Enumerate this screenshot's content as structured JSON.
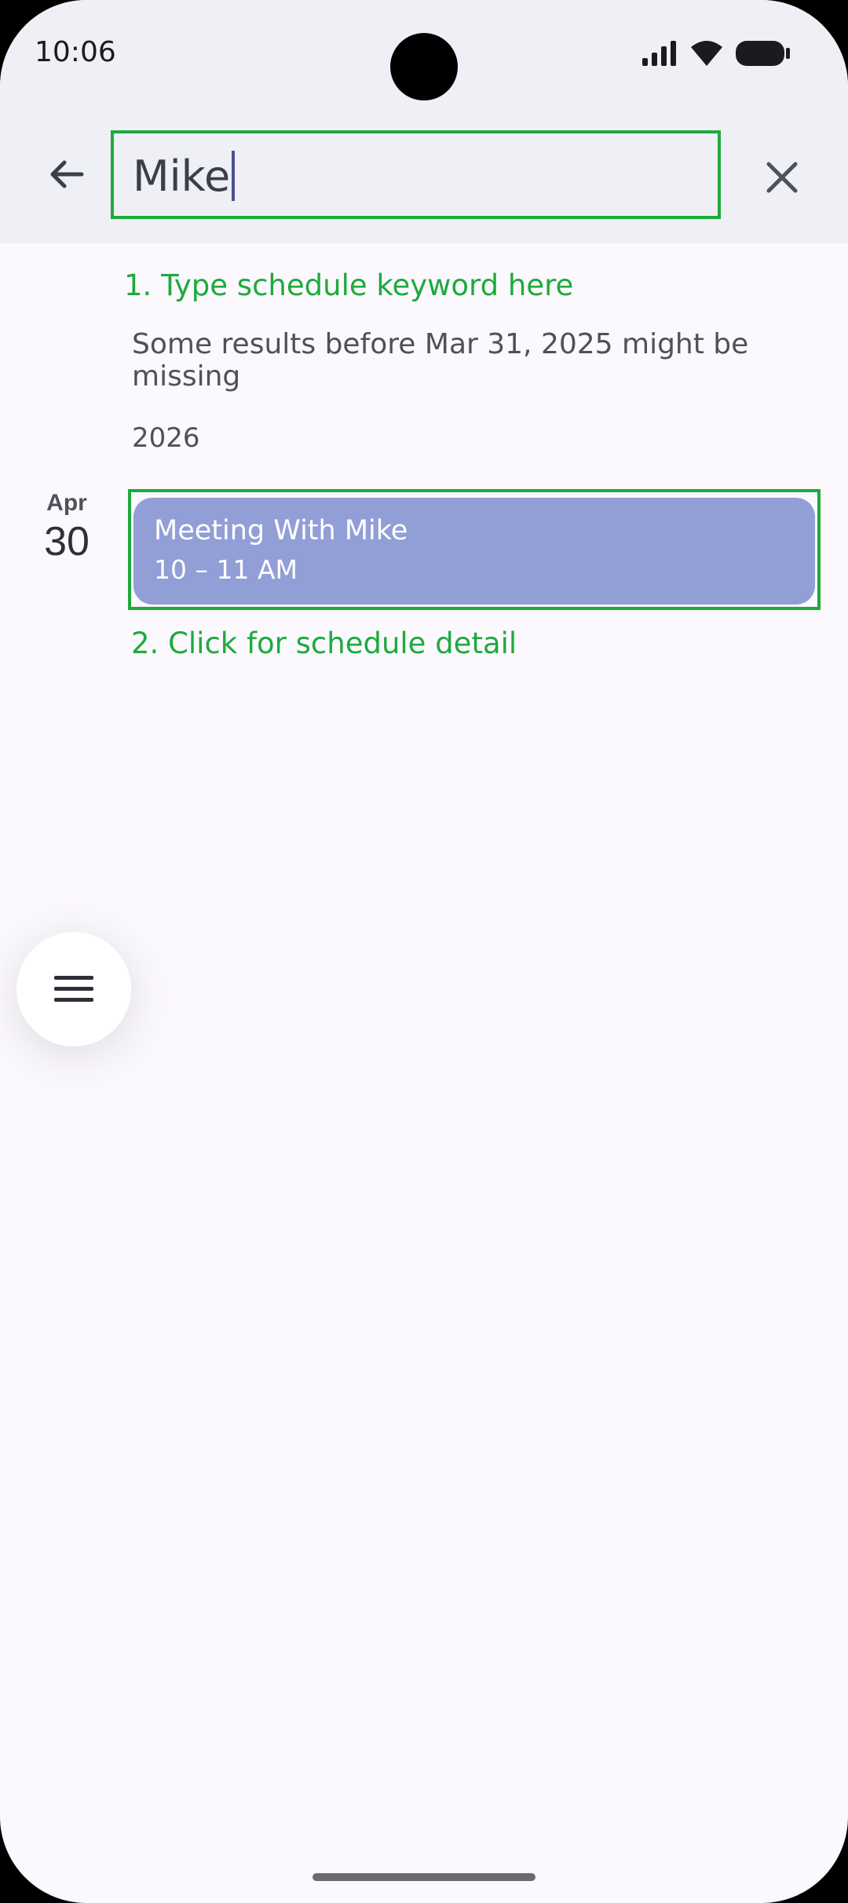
{
  "status_bar": {
    "time": "10:06",
    "icons": [
      "signal-icon",
      "wifi-icon",
      "battery-icon"
    ]
  },
  "search": {
    "value": "Mike",
    "back_icon": "arrow-left-icon",
    "clear_icon": "close-icon"
  },
  "annotations": {
    "step1": "1. Type schedule keyword here",
    "step2": "2. Click for schedule detail"
  },
  "results": {
    "note": "Some results before Mar 31, 2025 might be missing",
    "year": "2026",
    "events": [
      {
        "month": "Apr",
        "day": "30",
        "title": "Meeting With Mike",
        "time": "10 – 11 AM"
      }
    ]
  },
  "fab": {
    "icon": "menu-icon"
  },
  "colors": {
    "annotation": "#1eaa3c",
    "event_card": "#929ed6",
    "top_bar": "#eef0f6",
    "background": "#fbf8fe"
  }
}
